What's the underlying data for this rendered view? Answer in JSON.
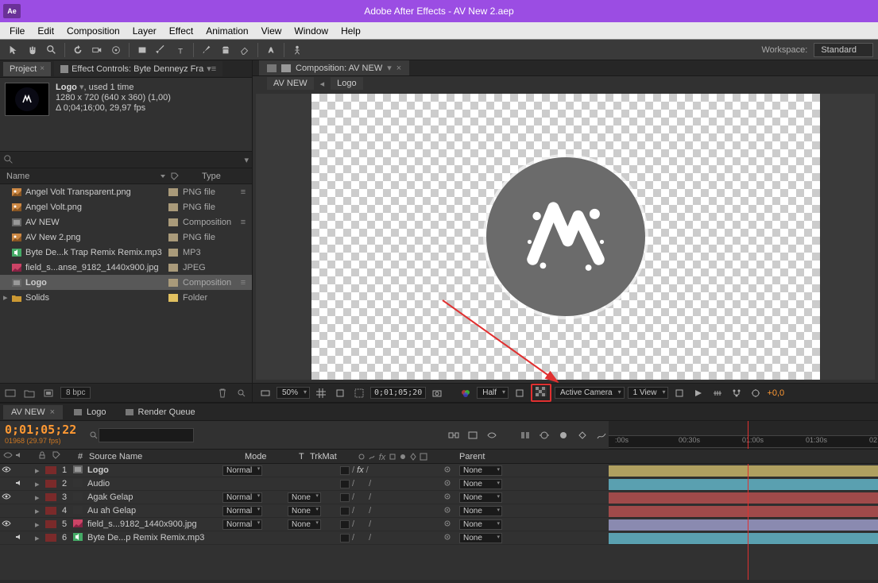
{
  "titlebar": {
    "app_icon": "Ae",
    "title": "Adobe After Effects - AV New 2.aep"
  },
  "menubar": [
    "File",
    "Edit",
    "Composition",
    "Layer",
    "Effect",
    "Animation",
    "View",
    "Window",
    "Help"
  ],
  "toolbar": {
    "workspace_label": "Workspace:",
    "workspace_value": "Standard"
  },
  "project_panel": {
    "tab_project": "Project",
    "tab_effect": "Effect Controls: Byte Denneyz Fra",
    "selected_name": "Logo",
    "selected_used": ", used 1 time",
    "dims": "1280 x 720   (640 x 360) (1,00)",
    "duration": "Δ 0;04;16;00, 29,97 fps",
    "cols": {
      "name": "Name",
      "type": "Type"
    },
    "items": [
      {
        "icon": "img",
        "name": "Angel Volt Transparent.png",
        "swatch": "#a99a7a",
        "type": "PNG file",
        "action": true
      },
      {
        "icon": "img",
        "name": "Angel Volt.png",
        "swatch": "#a99a7a",
        "type": "PNG file"
      },
      {
        "icon": "comp",
        "name": "AV NEW",
        "swatch": "#a99a7a",
        "type": "Composition",
        "action": true
      },
      {
        "icon": "img",
        "name": "AV New 2.png",
        "swatch": "#a99a7a",
        "type": "PNG file"
      },
      {
        "icon": "audio",
        "name": "Byte De...k Trap Remix Remix.mp3",
        "swatch": "#a99a7a",
        "type": "MP3"
      },
      {
        "icon": "img2",
        "name": "field_s...anse_9182_1440x900.jpg",
        "swatch": "#a99a7a",
        "type": "JPEG"
      },
      {
        "icon": "comp",
        "name": "Logo",
        "swatch": "#a99a7a",
        "type": "Composition",
        "selected": true,
        "bold": true,
        "action": true
      },
      {
        "icon": "folder",
        "name": "Solids",
        "swatch": "#e0c060",
        "type": "Folder",
        "twirl": true
      }
    ],
    "bpc": "8 bpc"
  },
  "composition": {
    "tab_label": "Composition: AV NEW",
    "breadcrumb": [
      "AV NEW",
      "Logo"
    ]
  },
  "viewer_controls": {
    "zoom": "50%",
    "timecode": "0;01;05;20",
    "quality": "Half",
    "camera": "Active Camera",
    "views": "1 View",
    "exposure": "+0,0"
  },
  "timeline": {
    "tabs": [
      {
        "label": "AV NEW",
        "active": true
      },
      {
        "label": "Logo"
      },
      {
        "label": "Render Queue"
      }
    ],
    "timecode": "0;01;05;22",
    "frames": "01968 (29.97 fps)",
    "cols": {
      "num": "#",
      "source": "Source Name",
      "mode": "Mode",
      "t": "T",
      "trkmat": "TrkMat",
      "parent": "Parent"
    },
    "ruler": [
      ":00s",
      "00:30s",
      "01:00s",
      "01:30s",
      "02"
    ],
    "layers": [
      {
        "eye": true,
        "num": 1,
        "color": "#7a2a2a",
        "icon": "comp",
        "name": "Logo",
        "mode": "Normal",
        "fx": true,
        "parent": "None",
        "bar": "#b0a060"
      },
      {
        "spk": true,
        "num": 2,
        "color": "#7a2a2a",
        "icon": "solid",
        "name": "Audio",
        "parent": "None",
        "bar": "#5aa0b0"
      },
      {
        "eye": true,
        "num": 3,
        "color": "#7a2a2a",
        "icon": "solid",
        "name": "Agak Gelap",
        "mode": "Normal",
        "trk": "None",
        "parent": "None",
        "bar": "#a04a4a"
      },
      {
        "num": 4,
        "color": "#7a2a2a",
        "icon": "solid",
        "name": "Au ah Gelap",
        "mode": "Normal",
        "trk": "None",
        "parent": "None",
        "bar": "#a04a4a"
      },
      {
        "eye": true,
        "num": 5,
        "color": "#7a2a2a",
        "icon": "img2",
        "name": "field_s...9182_1440x900.jpg",
        "mode": "Normal",
        "trk": "None",
        "parent": "None",
        "bar": "#8a8ab0"
      },
      {
        "spk": true,
        "num": 6,
        "color": "#7a2a2a",
        "icon": "audio",
        "name": "Byte De...p Remix Remix.mp3",
        "parent": "None",
        "bar": "#5aa0b0"
      }
    ]
  }
}
